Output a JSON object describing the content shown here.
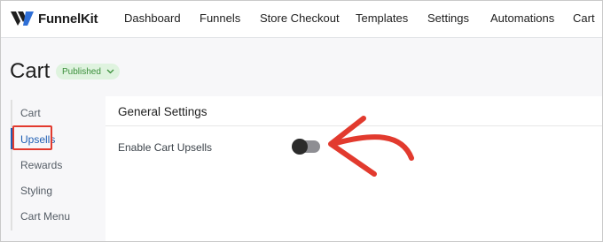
{
  "app": {
    "brand": "FunnelKit"
  },
  "nav": {
    "items": [
      {
        "label": "Dashboard"
      },
      {
        "label": "Funnels"
      },
      {
        "label": "Store Checkout"
      },
      {
        "label": "Templates"
      },
      {
        "label": "Settings"
      },
      {
        "label": "Automations"
      },
      {
        "label": "Cart"
      }
    ]
  },
  "page": {
    "title": "Cart",
    "status": "Published"
  },
  "side_menu": {
    "items": [
      {
        "label": "Cart"
      },
      {
        "label": "Upsells"
      },
      {
        "label": "Rewards"
      },
      {
        "label": "Styling"
      },
      {
        "label": "Cart Menu"
      }
    ],
    "active_index": 1
  },
  "panel": {
    "title": "General Settings",
    "settings": [
      {
        "label": "Enable Cart Upsells",
        "enabled": false
      }
    ]
  },
  "colors": {
    "accent": "#1f5fb4",
    "annotation": "#e23a2e",
    "badge_bg": "#dff3df",
    "badge_text": "#3a8f3a"
  }
}
